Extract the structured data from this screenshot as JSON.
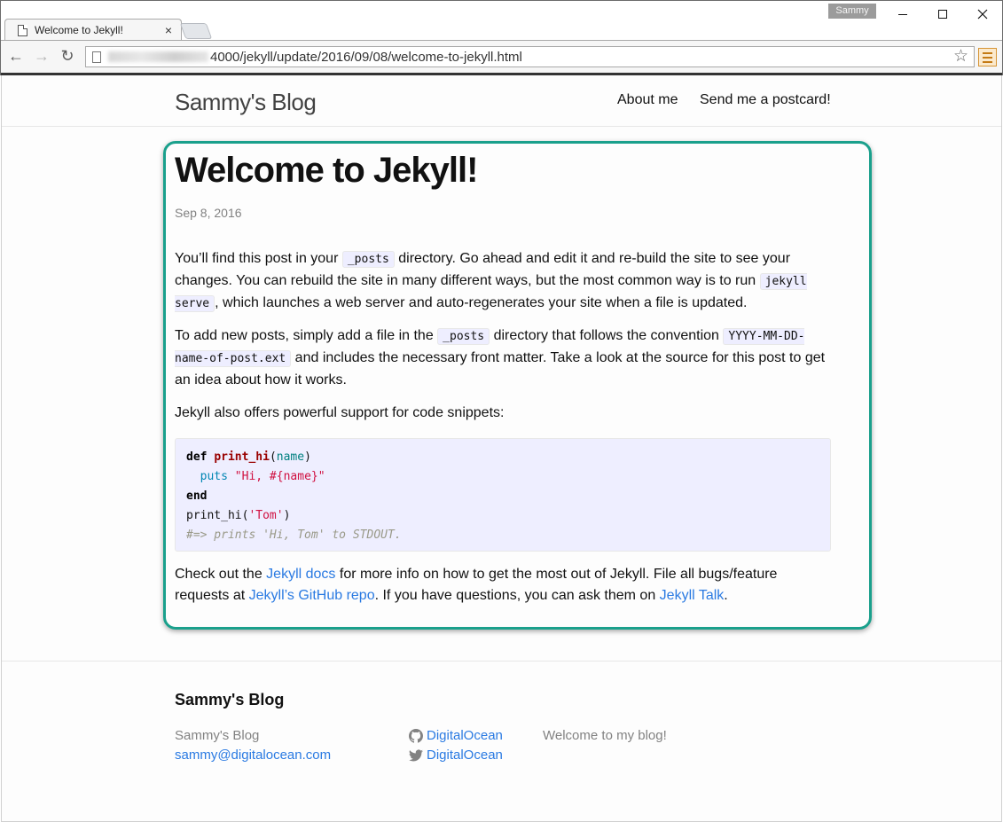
{
  "browser": {
    "tab_title": "Welcome to Jekyll!",
    "tab_close": "×",
    "profile_name": "Sammy",
    "url": "4000/jekyll/update/2016/09/08/welcome-to-jekyll.html",
    "back": "←",
    "forward": "→",
    "reload": "↻",
    "star": "☆"
  },
  "header": {
    "site_title": "Sammy's Blog",
    "nav": [
      "About me",
      "Send me a postcard!"
    ]
  },
  "post": {
    "title": "Welcome to Jekyll!",
    "date": "Sep 8, 2016",
    "p1": {
      "t1": "You’ll find this post in your ",
      "c1": "_posts",
      "t2": " directory. Go ahead and edit it and re-build the site to see your changes. You can rebuild the site in many different ways, but the most common way is to run ",
      "c2": "jekyll serve",
      "t3": ", which launches a web server and auto-regenerates your site when a file is updated."
    },
    "p2": {
      "t1": "To add new posts, simply add a file in the ",
      "c1": "_posts",
      "t2": " directory that follows the convention ",
      "c2": "YYYY-MM-DD-name-of-post.ext",
      "t3": " and includes the necessary front matter. Take a look at the source for this post to get an idea about how it works."
    },
    "p3": "Jekyll also offers powerful support for code snippets:",
    "code": {
      "l1_kw": "def",
      "l1_fn": "print_hi",
      "l1_open": "(",
      "l1_arg": "name",
      "l1_close": ")",
      "l2_indent": "  ",
      "l2_builtin": "puts",
      "l2_str": "\"Hi, #{name}\"",
      "l3_kw": "end",
      "l4_call": "print_hi(",
      "l4_str": "'Tom'",
      "l4_close": ")",
      "l5_comment": "#=> prints 'Hi, Tom' to STDOUT."
    },
    "p4": {
      "t1": "Check out the ",
      "l1": "Jekyll docs",
      "t2": " for more info on how to get the most out of Jekyll. File all bugs/feature requests at ",
      "l2": "Jekyll’s GitHub repo",
      "t3": ". If you have questions, you can ask them on ",
      "l3": "Jekyll Talk",
      "t4": "."
    }
  },
  "footer": {
    "heading": "Sammy's Blog",
    "name": "Sammy's Blog",
    "email": "sammy@digitalocean.com",
    "github": "DigitalOcean",
    "twitter": "DigitalOcean",
    "description": "Welcome to my blog!"
  },
  "colors": {
    "accent_frame": "#1aa08c",
    "link": "#2a7ae2"
  }
}
